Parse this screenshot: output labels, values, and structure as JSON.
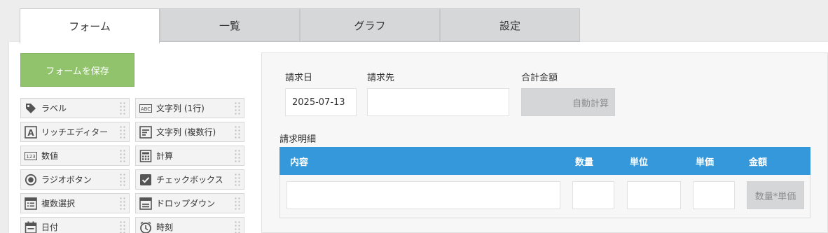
{
  "tabs": [
    {
      "label": "フォーム",
      "active": true
    },
    {
      "label": "一覧",
      "active": false
    },
    {
      "label": "グラフ",
      "active": false
    },
    {
      "label": "設定",
      "active": false
    }
  ],
  "sidebar": {
    "save_label": "フォームを保存",
    "palette": [
      {
        "label": "ラベル",
        "icon": "tag-icon"
      },
      {
        "label": "文字列 (1行)",
        "icon": "abc-text-icon"
      },
      {
        "label": "リッチエディター",
        "icon": "rich-editor-icon"
      },
      {
        "label": "文字列 (複数行)",
        "icon": "multiline-text-icon"
      },
      {
        "label": "数値",
        "icon": "number-icon"
      },
      {
        "label": "計算",
        "icon": "calculator-icon"
      },
      {
        "label": "ラジオボタン",
        "icon": "radio-button-icon"
      },
      {
        "label": "チェックボックス",
        "icon": "checkbox-icon"
      },
      {
        "label": "複数選択",
        "icon": "multi-select-icon"
      },
      {
        "label": "ドロップダウン",
        "icon": "dropdown-icon"
      },
      {
        "label": "日付",
        "icon": "calendar-icon"
      },
      {
        "label": "時刻",
        "icon": "clock-icon"
      }
    ]
  },
  "form": {
    "date_label": "請求日",
    "date_value": "2025-07-13",
    "client_label": "請求先",
    "client_value": "",
    "total_label": "合計金額",
    "total_value": "自動計算",
    "table_title": "請求明細",
    "columns": [
      "内容",
      "数量",
      "単位",
      "単価",
      "金額"
    ],
    "row_calc": "数量*単価"
  },
  "colors": {
    "accent": "#3498db",
    "save_button": "#91c36c",
    "tab_inactive": "#d5d7d8",
    "calc_field": "#d4d6d7"
  }
}
